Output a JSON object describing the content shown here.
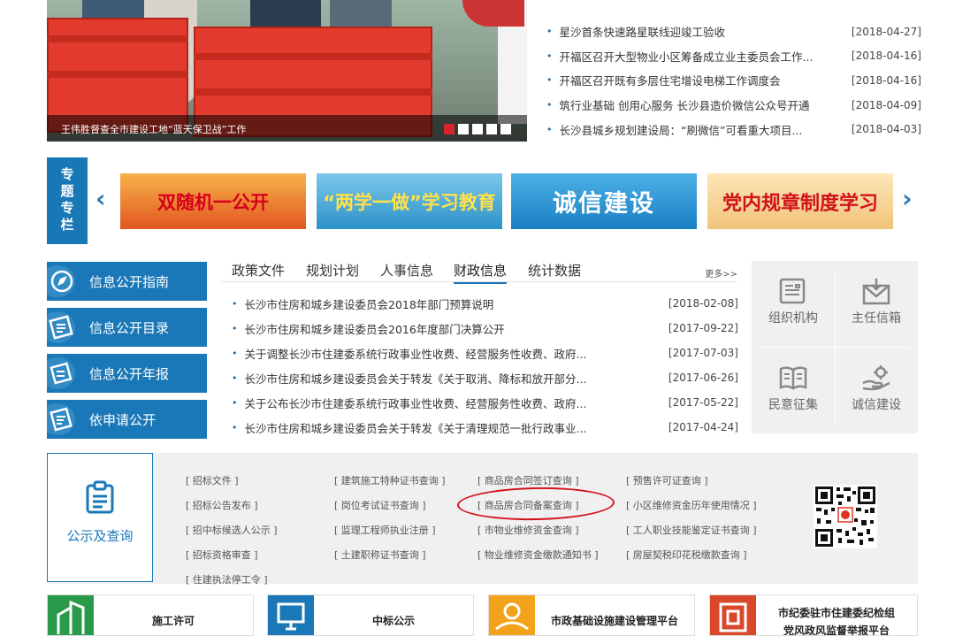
{
  "hero": {
    "caption": "王伟胜督查全市建设工地“蓝天保卫战”工作",
    "dots": 5,
    "active_dot": 0
  },
  "news_top": [
    {
      "title": "星沙首条快速路星联线迎竣工验收",
      "date": "[2018-04-27]"
    },
    {
      "title": "开福区召开大型物业小区筹备成立业主委员会工作...",
      "date": "[2018-04-16]"
    },
    {
      "title": "开福区召开既有多层住宅增设电梯工作调度会",
      "date": "[2018-04-16]"
    },
    {
      "title": "筑行业基础 创用心服务 长沙县造价微信公众号开通",
      "date": "[2018-04-09]"
    },
    {
      "title": "长沙县城乡规划建设局：“刷微信”可看重大项目...",
      "date": "[2018-04-03]"
    }
  ],
  "special": {
    "label_chars": [
      "专",
      "题",
      "专",
      "栏"
    ],
    "prev_arrow": "‹",
    "next_arrow": "›",
    "banners": [
      "双随机一公开",
      "“两学一做”学习教育",
      "诚信建设",
      "党内规章制度学习"
    ]
  },
  "left_menu": [
    "信息公开指南",
    "信息公开目录",
    "信息公开年报",
    "依申请公开"
  ],
  "tabs": {
    "items": [
      "政策文件",
      "规划计划",
      "人事信息",
      "财政信息",
      "统计数据"
    ],
    "active": 3,
    "more": "更多>>"
  },
  "news_mid": [
    {
      "title": "长沙市住房和城乡建设委员会2018年部门预算说明",
      "date": "[2018-02-08]"
    },
    {
      "title": "长沙市住房和城乡建设委员会2016年度部门决算公开",
      "date": "[2017-09-22]"
    },
    {
      "title": "关于调整长沙市住建委系统行政事业性收费、经营服务性收费、政府...",
      "date": "[2017-07-03]"
    },
    {
      "title": "长沙市住房和城乡建设委员会关于转发《关于取消、降标和放开部分...",
      "date": "[2017-06-26]"
    },
    {
      "title": "关于公布长沙市住建委系统行政事业性收费、经营服务性收费、政府...",
      "date": "[2017-05-22]"
    },
    {
      "title": "长沙市住房和城乡建设委员会关于转发《关于清理规范一批行政事业...",
      "date": "[2017-04-24]"
    }
  ],
  "right_grid": [
    "组织机构",
    "主任信箱",
    "民意征集",
    "诚信建设"
  ],
  "query": {
    "label": "公示及查询",
    "links": [
      [
        "[ 招标文件 ]",
        "[ 建筑施工特种证书查询 ]",
        "[ 商品房合同签订查询 ]",
        "[ 预售许可证查询 ]"
      ],
      [
        "[ 招标公告发布 ]",
        "[ 岗位考试证书查询 ]",
        "[ 商品房合同备案查询 ]",
        "[ 小区维修资金历年使用情况 ]"
      ],
      [
        "[ 招中标候选人公示 ]",
        "[ 监理工程师执业注册 ]",
        "[ 市物业维修资金查询 ]",
        "[ 工人职业技能鉴定证书查询 ]"
      ],
      [
        "[ 招标资格审查 ]",
        "[ 土建职称证书查询 ]",
        "[ 物业维修资金缴款通知书 ]",
        "[ 房屋契税印花税缴款查询 ]"
      ],
      [
        "[ 住建执法停工令 ]"
      ]
    ]
  },
  "tiles": [
    {
      "label": "施工许可",
      "color": "#2a9a4a"
    },
    {
      "label": "中标公示",
      "color": "#1b78b8"
    },
    {
      "label": "市政基础设施建设管理平台",
      "color": "#f2a31b"
    },
    {
      "label": "市纪委驻市住建委纪检组",
      "label2": "党风政风监督举报平台",
      "color": "#d9482b"
    }
  ]
}
